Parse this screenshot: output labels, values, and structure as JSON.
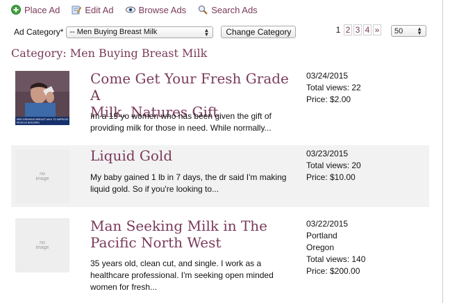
{
  "nav": {
    "place_ad": "Place Ad",
    "edit_ad": "Edit Ad",
    "browse_ads": "Browse Ads",
    "search_ads": "Search Ads"
  },
  "category_filter": {
    "label": "Ad Category*",
    "selected": "-- Men Buying Breast Milk",
    "change_button": "Change Category"
  },
  "pagination": {
    "current": "1",
    "pages": [
      "2",
      "3",
      "4"
    ],
    "next": "»",
    "per_page": "50"
  },
  "category_heading": "Category: Men Buying Breast Milk",
  "listings": [
    {
      "title_line1": "Come Get Your Fresh Grade A",
      "title_line2": "Milk. Natures Gift",
      "desc_line1": "Im a 19 yo women who has been given the gift of",
      "desc_line2": "providing milk for those in need. While normally...",
      "date": "03/24/2015",
      "views": "Total views: 22",
      "price": "Price: $2.00",
      "thumb_caption_1": "MEN DRINKING BREAST MILK TO IMPROVE",
      "thumb_caption_2": "MUSCLE BUILDING"
    },
    {
      "title_line1": "Liquid Gold",
      "desc_line1": "My baby gained 1 lb in 7 days, the dr said I'm making",
      "desc_line2": "liquid gold. So if you're looking to...",
      "date": "03/23/2015",
      "views": "Total views: 20",
      "price": "Price: $10.00",
      "no_image_1": "no",
      "no_image_2": "image"
    },
    {
      "title_line1": "Man Seeking Milk in The",
      "title_line2": "Pacific North West",
      "desc_line1": "35 years old, clean cut, and single. I work as a",
      "desc_line2": "healthcare professional. I'm seeking open minded",
      "desc_line3": "women for fresh...",
      "date": "03/22/2015",
      "city": "Portland",
      "state": "Oregon",
      "views": "Total views: 140",
      "price": "Price: $200.00",
      "no_image_1": "no",
      "no_image_2": "image"
    }
  ],
  "colors": {
    "accent": "#7a3a5a",
    "alt_row": "#f2f2f2",
    "no_image_bg": "#eeeeee"
  },
  "icons": [
    "plus-circle-icon",
    "edit-pencil-icon",
    "eye-icon",
    "magnifier-icon"
  ]
}
